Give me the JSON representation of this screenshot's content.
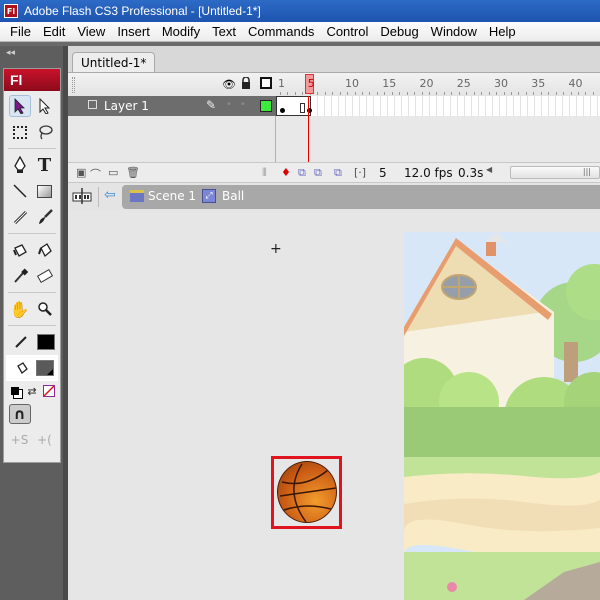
{
  "window": {
    "title": "Adobe Flash CS3 Professional - [Untitled-1*]",
    "app_icon": "Fl"
  },
  "menu": [
    "File",
    "Edit",
    "View",
    "Insert",
    "Modify",
    "Text",
    "Commands",
    "Control",
    "Debug",
    "Window",
    "Help"
  ],
  "toolbar": {
    "collapse_glyph": "◂◂",
    "logo": "Fl",
    "tools": [
      {
        "name": "selection-tool",
        "glyph": "➤",
        "active": true
      },
      {
        "name": "subselection-tool",
        "glyph": "↖"
      },
      {
        "name": "free-transform-tool",
        "glyph": "⬚"
      },
      {
        "name": "lasso-tool",
        "glyph": "➰"
      },
      {
        "name": "pen-tool",
        "glyph": "✒"
      },
      {
        "name": "text-tool",
        "glyph": "T"
      },
      {
        "name": "line-tool",
        "glyph": "╲"
      },
      {
        "name": "rectangle-tool",
        "glyph": "▭"
      },
      {
        "name": "pencil-tool",
        "glyph": "✏"
      },
      {
        "name": "brush-tool",
        "glyph": "🖌"
      },
      {
        "name": "ink-bottle-tool",
        "glyph": "⛀"
      },
      {
        "name": "paint-bucket-tool",
        "glyph": "⛁"
      },
      {
        "name": "eyedropper-tool",
        "glyph": "⚲"
      },
      {
        "name": "eraser-tool",
        "glyph": "⌫"
      },
      {
        "name": "hand-tool",
        "glyph": "✋"
      },
      {
        "name": "zoom-tool",
        "glyph": "🔍"
      }
    ],
    "stroke_color": "#000000",
    "fill_color": "#5a5a5a",
    "snap_glyph": "∩",
    "smooth_glyph": "+S",
    "straighten_glyph": "+("
  },
  "document": {
    "tab_label": "Untitled-1*"
  },
  "timeline": {
    "ruler_ticks": [
      "1",
      "5",
      "10",
      "15",
      "20",
      "25",
      "30",
      "35",
      "40"
    ],
    "current_frame": "5",
    "layers": [
      {
        "name": "Layer 1",
        "outline_color": "#3cea3c"
      }
    ],
    "footer": {
      "frame": "5",
      "fps": "12.0 fps",
      "time": "0.3s"
    }
  },
  "editbar": {
    "scene_label": "Scene 1",
    "symbol_label": "Ball"
  },
  "stage": {
    "selected_symbol": "basketball"
  }
}
